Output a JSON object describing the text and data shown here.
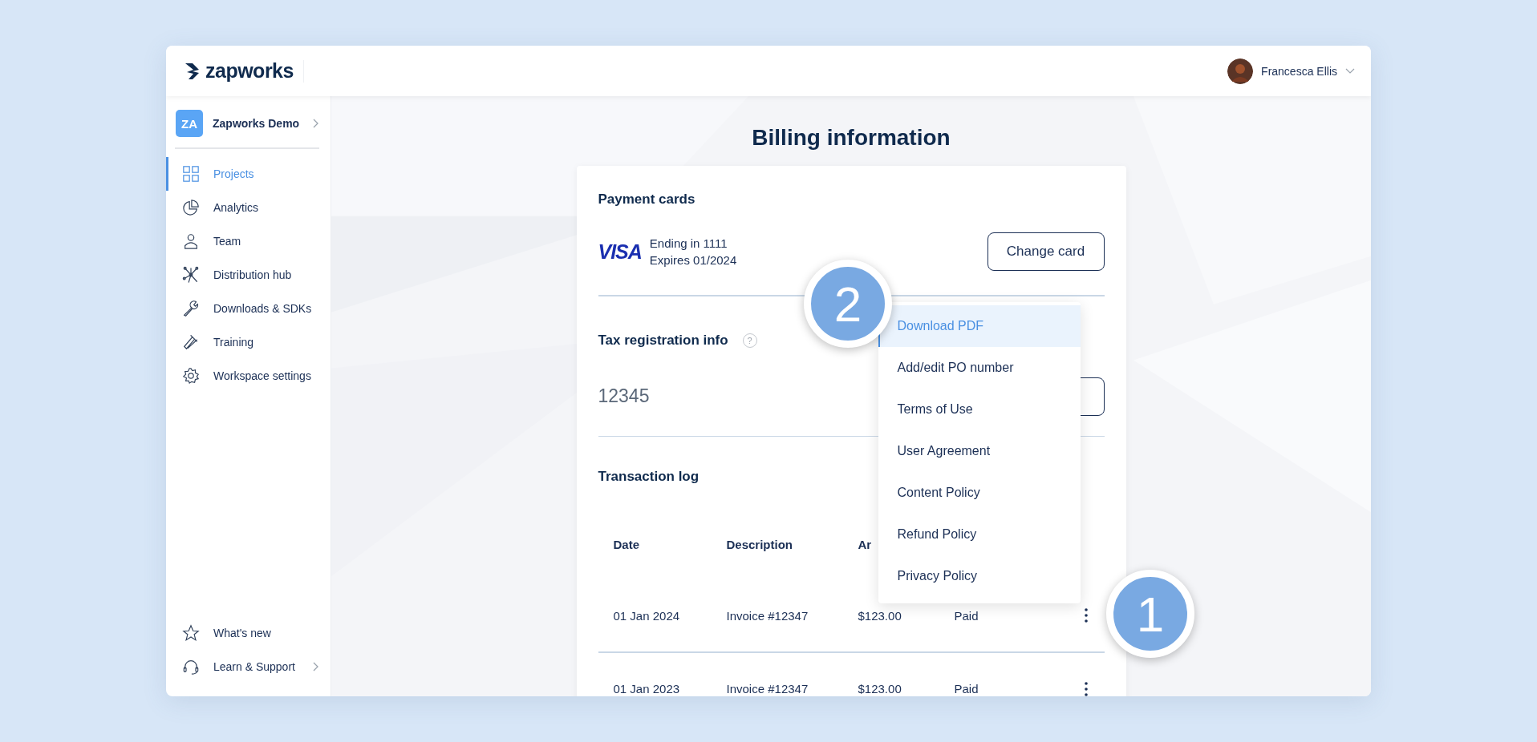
{
  "header": {
    "logo": "zapworks",
    "user": {
      "name": "Francesca Ellis"
    }
  },
  "sidebar": {
    "workspace": {
      "initials": "ZA",
      "name": "Zapworks Demo"
    },
    "items": [
      {
        "label": "Projects",
        "selected": true
      },
      {
        "label": "Analytics",
        "selected": false
      },
      {
        "label": "Team",
        "selected": false
      },
      {
        "label": "Distribution hub",
        "selected": false
      },
      {
        "label": "Downloads & SDKs",
        "selected": false
      },
      {
        "label": "Training",
        "selected": false
      },
      {
        "label": "Workspace settings",
        "selected": false
      }
    ],
    "footer_items": [
      {
        "label": "What's new",
        "has_submenu": false
      },
      {
        "label": "Learn & Support",
        "has_submenu": true
      }
    ]
  },
  "page_title": "Billing information",
  "payment_cards": {
    "title": "Payment cards",
    "brand": "VISA",
    "ending": "Ending in 1111",
    "expires": "Expires 01/2024",
    "button": "Change card"
  },
  "tax": {
    "title": "Tax registration info",
    "help": "?",
    "value": "12345"
  },
  "transactions": {
    "title": "Transaction log",
    "columns": [
      "Date",
      "Description",
      "Ar"
    ],
    "rows": [
      {
        "cells": [
          "01 Jan 2024",
          "Invoice #12347",
          "$123.00",
          "Paid"
        ]
      },
      {
        "cells": [
          "01 Jan 2023",
          "Invoice #12347",
          "$123.00",
          "Paid"
        ]
      }
    ]
  },
  "menu": {
    "items": [
      {
        "label": "Download PDF",
        "selected": true
      },
      {
        "label": "Add/edit PO number",
        "selected": false
      },
      {
        "label": "Terms of Use",
        "selected": false
      },
      {
        "label": "User Agreement",
        "selected": false
      },
      {
        "label": "Content Policy",
        "selected": false
      },
      {
        "label": "Refund Policy",
        "selected": false
      },
      {
        "label": "Privacy Policy",
        "selected": false
      }
    ]
  },
  "callouts": [
    {
      "number": "2"
    },
    {
      "number": "1"
    }
  ]
}
